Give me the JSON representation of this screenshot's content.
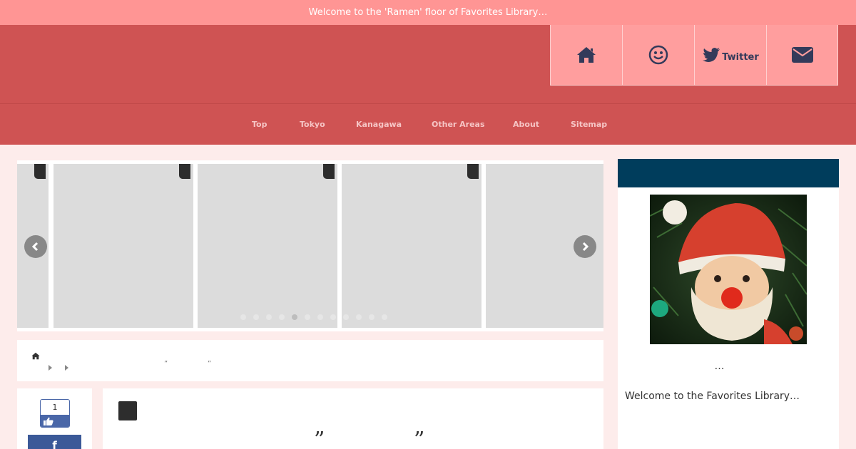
{
  "notice": {
    "text": "Welcome to the 'Ramen' floor of Favorites Library…"
  },
  "social": [
    {
      "icon": "home-icon",
      "label": ""
    },
    {
      "icon": "smiley-icon",
      "label": ""
    },
    {
      "icon": "twitter-icon",
      "label": "Twitter"
    },
    {
      "icon": "mail-icon",
      "label": ""
    }
  ],
  "nav": {
    "items": [
      {
        "label": "Top"
      },
      {
        "label": "Tokyo"
      },
      {
        "label": "Kanagawa"
      },
      {
        "label": "Other Areas"
      },
      {
        "label": "About"
      },
      {
        "label": "Sitemap"
      }
    ]
  },
  "carousel": {
    "slide_count": 12,
    "active_slide": 5
  },
  "breadcrumb": {
    "quote_open": "”",
    "quote_close": "”"
  },
  "share": {
    "like_count": "1",
    "facebook_label": "f"
  },
  "article": {
    "quote_open": "”",
    "quote_close": "”"
  },
  "sidebar": {
    "ellipsis": "…",
    "welcome_text": "Welcome to the Favorites Library…"
  },
  "colors": {
    "notice_bg": "#ff9594",
    "header_bg": "#cf5353",
    "social_bg": "#ff9e9e",
    "sidebar_head": "#003d5c",
    "facebook": "#3b5998"
  }
}
